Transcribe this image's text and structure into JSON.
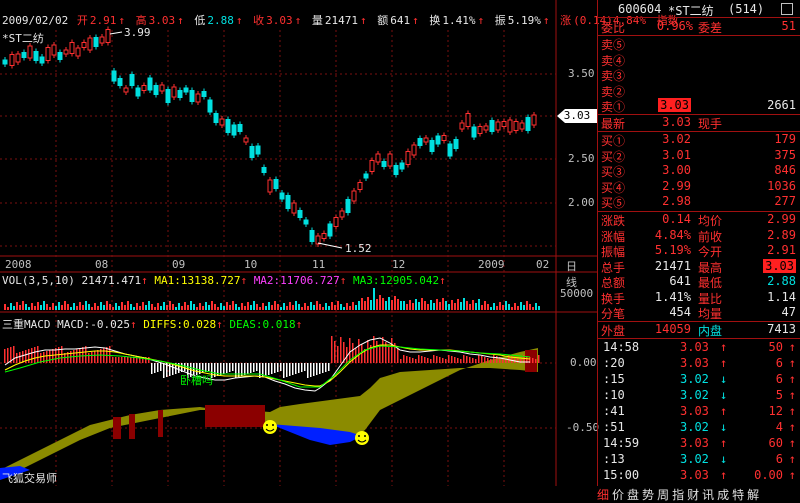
{
  "header": {
    "title": "*ST二纺",
    "date": "2009/02/02",
    "open_label": "开",
    "open": "2.91",
    "high_label": "高",
    "high": "3.03",
    "low_label": "低",
    "low": "2.88",
    "close_label": "收",
    "close": "3.03",
    "vol_label": "量",
    "vol": "21471",
    "amount_label": "额",
    "amount": "641",
    "turnover_label": "换",
    "turnover": "1.41%",
    "amplitude_label": "振",
    "amplitude": "5.19%",
    "change_label": "涨",
    "change": "(0.14)4.84%",
    "index_label": "指数"
  },
  "price_axis": {
    "labels": [
      "3.50",
      "3.00",
      "2.50",
      "2.00"
    ],
    "current_tag": "3.03",
    "max_label": "3.99",
    "min_label": "1.52"
  },
  "date_axis": [
    "2008",
    "08",
    "09",
    "10",
    "11",
    "12",
    "2009",
    "02"
  ],
  "period_label": "日线",
  "vol_panel": {
    "title": "VOL(3,5,10)",
    "value": "21471.471",
    "ma1": "MA1:13138.727",
    "ma2": "MA2:11706.727",
    "ma3": "MA3:12905.042",
    "axis_label": "50000"
  },
  "macd_panel": {
    "title": "三重MACD",
    "macd": "MACD:-0.025",
    "diffs": "DIFFS:0.028",
    "deas": "DEAS:0.018",
    "axis_labels": [
      "0.00",
      "-0.50"
    ],
    "annotation": "卧槽吗",
    "footer": "飞狐交易师"
  },
  "panel": {
    "code": "600604",
    "name": "*ST二纺",
    "count": "(514)",
    "weibi_label": "委比",
    "weibi": "0.96%",
    "weicha_label": "委差",
    "weicha": "51",
    "sell": [
      {
        "label": "卖⑤",
        "price": "",
        "vol": ""
      },
      {
        "label": "卖④",
        "price": "",
        "vol": ""
      },
      {
        "label": "卖③",
        "price": "",
        "vol": ""
      },
      {
        "label": "卖②",
        "price": "",
        "vol": ""
      },
      {
        "label": "卖①",
        "price": "3.03",
        "vol": "2661"
      }
    ],
    "latest_label": "最新",
    "latest": "3.03",
    "xianshou_label": "现手",
    "buy": [
      {
        "label": "买①",
        "price": "3.02",
        "vol": "179"
      },
      {
        "label": "买②",
        "price": "3.01",
        "vol": "375"
      },
      {
        "label": "买③",
        "price": "3.00",
        "vol": "846"
      },
      {
        "label": "买④",
        "price": "2.99",
        "vol": "1036"
      },
      {
        "label": "买⑤",
        "price": "2.98",
        "vol": "277"
      }
    ],
    "stats": [
      {
        "l1": "涨跌",
        "v1": "0.14",
        "l2": "均价",
        "v2": "2.99"
      },
      {
        "l1": "涨幅",
        "v1": "4.84%",
        "l2": "前收",
        "v2": "2.89"
      },
      {
        "l1": "振幅",
        "v1": "5.19%",
        "l2": "今开",
        "v2": "2.91"
      },
      {
        "l1": "总手",
        "v1": "21471",
        "l2": "最高",
        "v2": "3.03"
      },
      {
        "l1": "总额",
        "v1": "641",
        "l2": "最低",
        "v2": "2.88"
      },
      {
        "l1": "换手",
        "v1": "1.41%",
        "l2": "量比",
        "v2": "1.14"
      },
      {
        "l1": "分笔",
        "v1": "454",
        "l2": "均量",
        "v2": "47"
      }
    ],
    "outer_label": "外盘",
    "outer": "14059",
    "inner_label": "内盘",
    "inner": "7413",
    "ticks": [
      {
        "t": "14:58",
        "p": "3.03",
        "a": "↑",
        "v": "50"
      },
      {
        "t": ":20",
        "p": "3.03",
        "a": "↑",
        "v": "6"
      },
      {
        "t": ":15",
        "p": "3.02",
        "a": "↓",
        "v": "6"
      },
      {
        "t": ":10",
        "p": "3.02",
        "a": "↓",
        "v": "5"
      },
      {
        "t": ":41",
        "p": "3.03",
        "a": "↑",
        "v": "12"
      },
      {
        "t": ":51",
        "p": "3.02",
        "a": "↓",
        "v": "4"
      },
      {
        "t": "14:59",
        "p": "3.03",
        "a": "↑",
        "v": "60"
      },
      {
        "t": ":13",
        "p": "3.02",
        "a": "↓",
        "v": "6"
      },
      {
        "t": "15:00",
        "p": "3.03",
        "a": "↑",
        "v": "0.00"
      }
    ],
    "menu": [
      "细",
      "价",
      "盘",
      "势",
      "周",
      "指",
      "财",
      "讯",
      "成",
      "特",
      "解"
    ]
  },
  "colors": {
    "up": "#ff3030",
    "down": "#00e0e0",
    "grid": "#7a1010",
    "macd_fill": "#8b8b00",
    "macd_blue": "#0020ff",
    "macd_dark": "#8b0000"
  }
}
